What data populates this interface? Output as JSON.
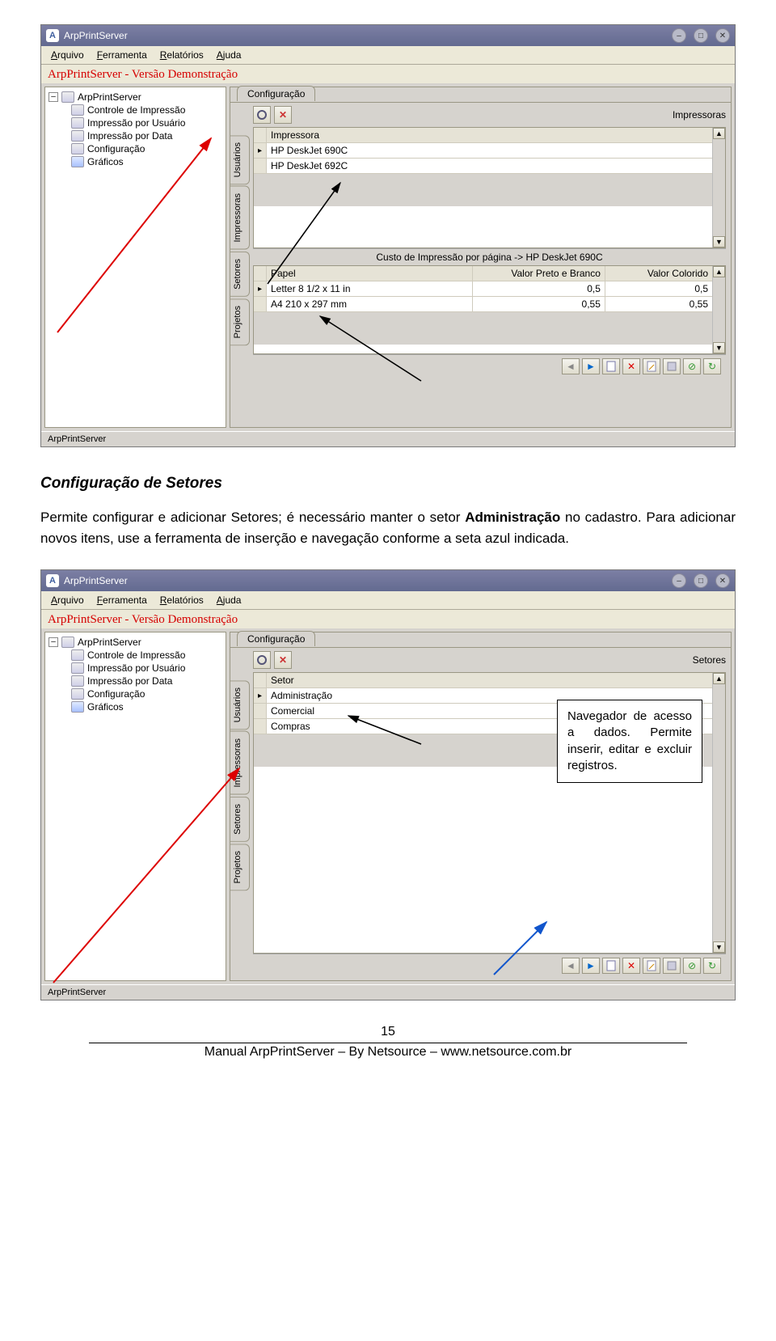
{
  "doc": {
    "heading": "Configuração de Setores",
    "para_before_bold": "Permite configurar e adicionar Setores; é necessário manter o setor ",
    "para_bold": "Administração",
    "para_after_bold": " no cadastro. Para adicionar novos itens, use a ferramenta de inserção e navegação conforme a seta azul indicada.",
    "callout": "Navegador de acesso a dados. Permite inserir, editar e excluir registros.",
    "page_number": "15",
    "footer": "Manual ArpPrintServer – By Netsource – www.netsource.com.br"
  },
  "app": {
    "title": "ArpPrintServer",
    "menu": {
      "arquivo": "Arquivo",
      "ferramenta": "Ferramenta",
      "relatorios": "Relatórios",
      "ajuda": "Ajuda"
    },
    "demo_label": "ArpPrintServer - Versão Demonstração",
    "status": "ArpPrintServer",
    "config_tab": "Configuração",
    "side_tabs": {
      "usuarios": "Usuários",
      "impressoras": "Impressoras",
      "setores": "Setores",
      "projetos": "Projetos"
    },
    "tree": {
      "root": "ArpPrintServer",
      "items": [
        "Controle de Impressão",
        "Impressão por Usuário",
        "Impressão por Data",
        "Configuração",
        "Gráficos"
      ]
    }
  },
  "screenshot1": {
    "panel_label": "Impressoras",
    "grid_header": "Impressora",
    "printers": [
      "HP DeskJet 690C",
      "HP DeskJet 692C"
    ],
    "cost_title": "Custo de Impressão por página -> HP DeskJet 690C",
    "cost_headers": {
      "papel": "Papel",
      "bw": "Valor Preto e Branco",
      "color": "Valor Colorido"
    },
    "cost_rows": [
      {
        "papel": "Letter 8 1/2 x 11 in",
        "bw": "0,5",
        "color": "0,5"
      },
      {
        "papel": "A4 210 x 297 mm",
        "bw": "0,55",
        "color": "0,55"
      }
    ]
  },
  "screenshot2": {
    "panel_label": "Setores",
    "grid_header": "Setor",
    "setores": [
      "Administração",
      "Comercial",
      "Compras"
    ]
  }
}
